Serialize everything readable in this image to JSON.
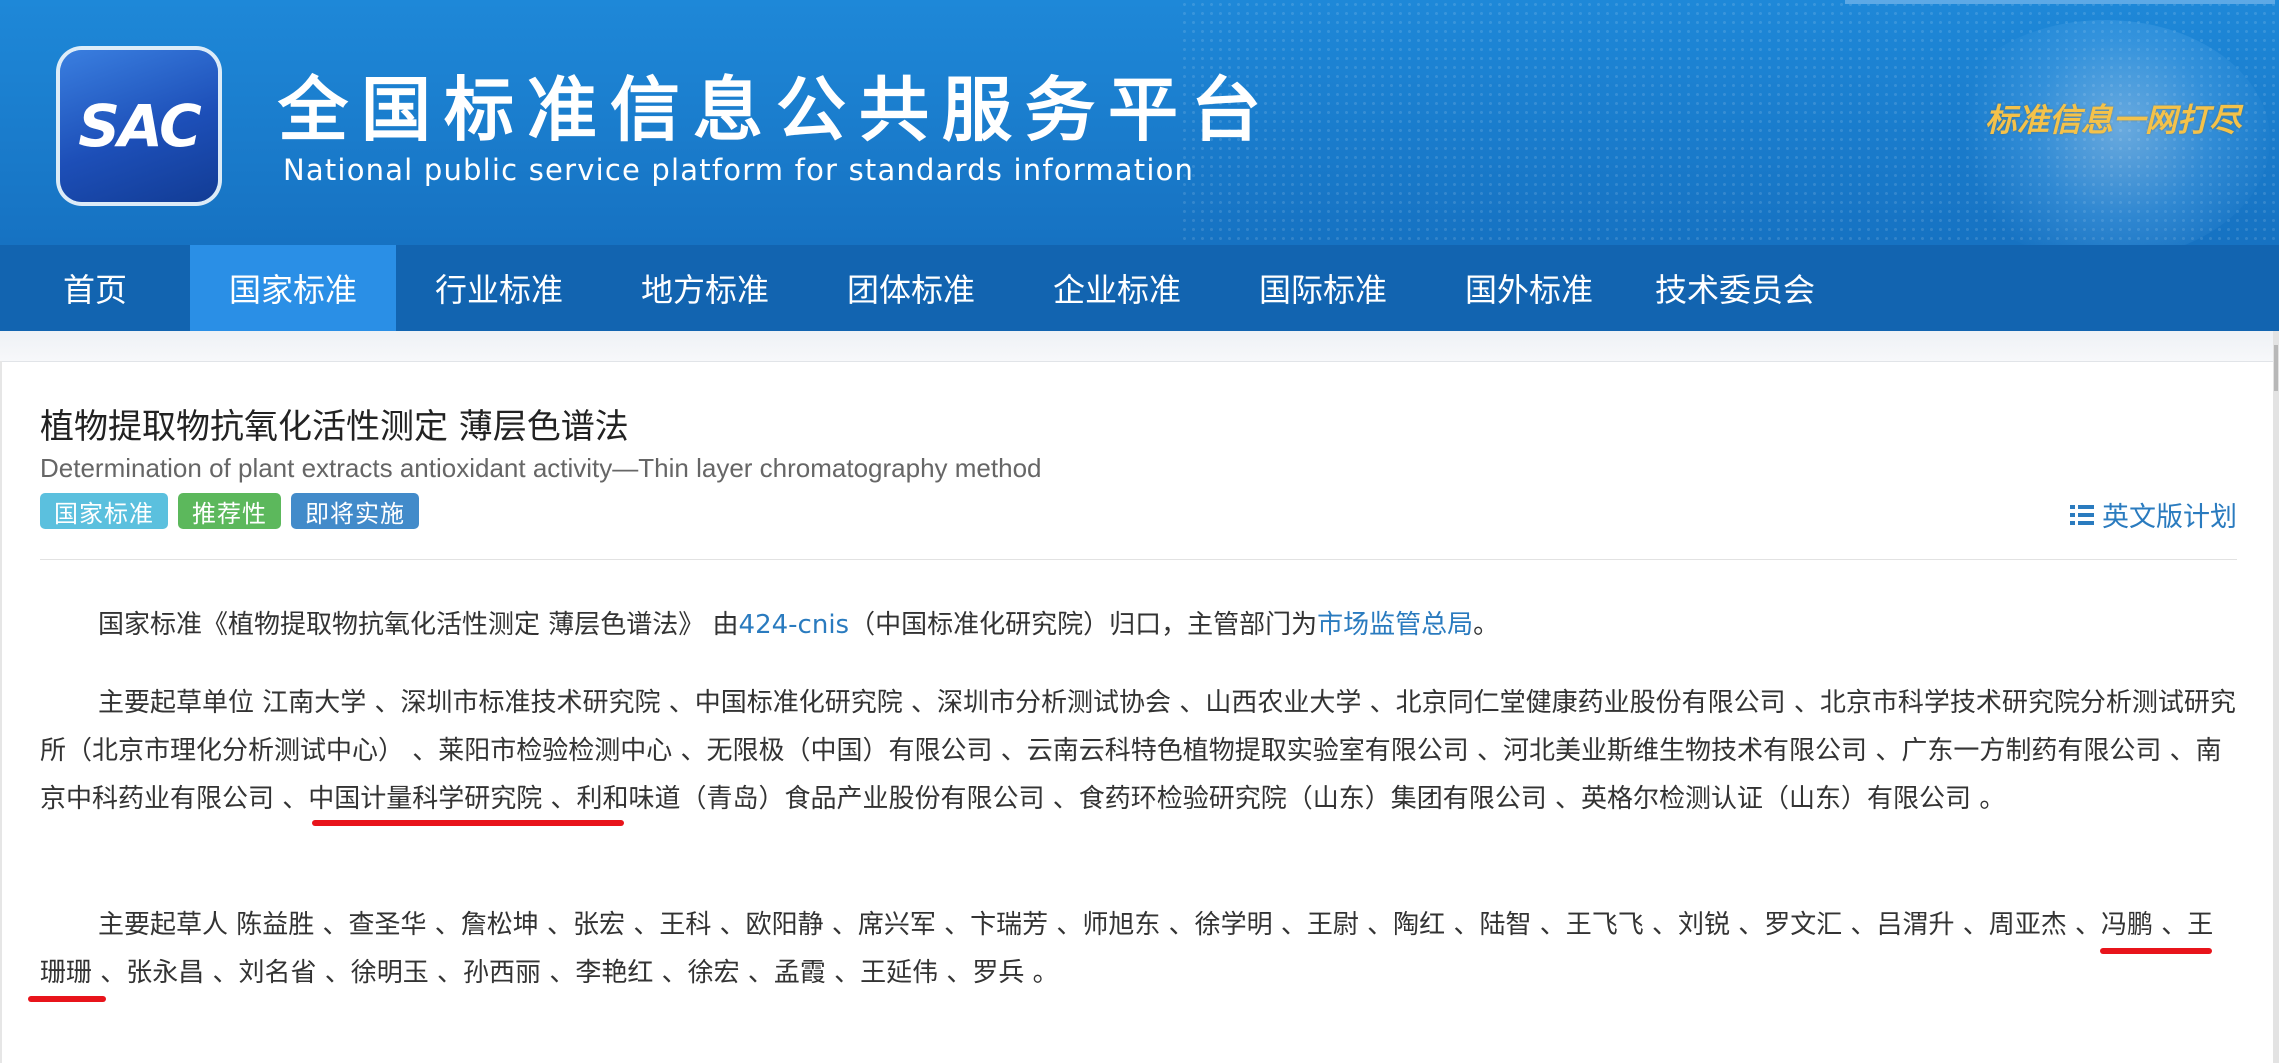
{
  "header": {
    "logo_text": "SAC",
    "title": "全国标准信息公共服务平台",
    "subtitle": "National public service platform  for standards information",
    "slogan": "标准信息一网打尽"
  },
  "nav": {
    "items": [
      {
        "label": "首页",
        "active": false
      },
      {
        "label": "国家标准",
        "active": true
      },
      {
        "label": "行业标准",
        "active": false
      },
      {
        "label": "地方标准",
        "active": false
      },
      {
        "label": "团体标准",
        "active": false
      },
      {
        "label": "企业标准",
        "active": false
      },
      {
        "label": "国际标准",
        "active": false
      },
      {
        "label": "国外标准",
        "active": false
      },
      {
        "label": "技术委员会",
        "active": false
      }
    ]
  },
  "standard": {
    "title": "植物提取物抗氧化活性测定 薄层色谱法",
    "title_en": "Determination of plant extracts antioxidant activity—Thin layer chromatography method",
    "tags": [
      "国家标准",
      "推荐性",
      "即将实施"
    ],
    "en_plan_label": "英文版计划"
  },
  "intro": {
    "prefix": "国家标准《植物提取物抗氧化活性测定 薄层色谱法》 由",
    "tc_link": "424-cnis",
    "middle": "（中国标准化研究院）归口，主管部门为",
    "dept_link": "市场监管总局",
    "suffix": "。"
  },
  "drafting_units": {
    "text": "主要起草单位 江南大学 、深圳市标准技术研究院 、中国标准化研究院 、深圳市分析测试协会 、山西农业大学 、北京同仁堂健康药业股份有限公司 、北京市科学技术研究院分析测试研究所（北京市理化分析测试中心） 、莱阳市检验检测中心 、无限极（中国）有限公司 、云南云科特色植物提取实验室有限公司 、河北美业斯维生物技术有限公司 、广东一方制药有限公司 、南京中科药业有限公司 、中国计量科学研究院 、利和味道（青岛）食品产业股份有限公司 、食药环检验研究院（山东）集团有限公司 、英格尔检测认证（山东）有限公司 。"
  },
  "drafters": {
    "text": "主要起草人 陈益胜 、查圣华 、詹松坤 、张宏 、王科 、欧阳静 、席兴军 、卞瑞芳 、师旭东 、徐学明 、王尉 、陶红 、陆智 、王飞飞 、刘锐 、罗文汇 、吕渭升 、周亚杰 、冯鹏 、王珊珊 、张永昌 、刘名省 、徐明玉 、孙西丽 、李艳红 、徐宏 、孟霞 、王延伟 、罗兵 。"
  },
  "colors": {
    "banner": "#1a7ccc",
    "nav": "#1264b0",
    "nav_active": "#2a8fe6",
    "link": "#2a7bbf",
    "highlight_underline": "#e8141b"
  }
}
